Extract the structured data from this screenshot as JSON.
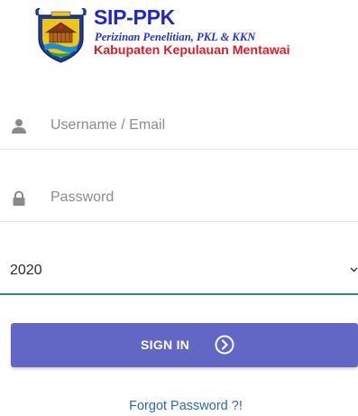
{
  "header": {
    "title": "SIP-PPK",
    "subtitle": "Perizinan Penelitian, PKL & KKN",
    "region": "Kabupaten Kepulauan Mentawai",
    "logo_icon": "regency-emblem-icon"
  },
  "login_form": {
    "username": {
      "placeholder": "Username / Email",
      "value": "",
      "icon": "user-icon"
    },
    "password": {
      "placeholder": "Password",
      "value": "",
      "icon": "lock-icon"
    },
    "year": {
      "selected": "2020",
      "icon": "chevron-down-icon"
    },
    "sign_in_label": "SIGN IN",
    "sign_in_icon": "arrow-circle-right-icon",
    "forgot_password_label": "Forgot Password ?!"
  },
  "colors": {
    "title_blue": "#1f27c8",
    "region_red": "#e01b28",
    "button_purple": "#6267c5",
    "select_underline_teal": "#2a8c87",
    "link_blue": "#2b67b3"
  }
}
